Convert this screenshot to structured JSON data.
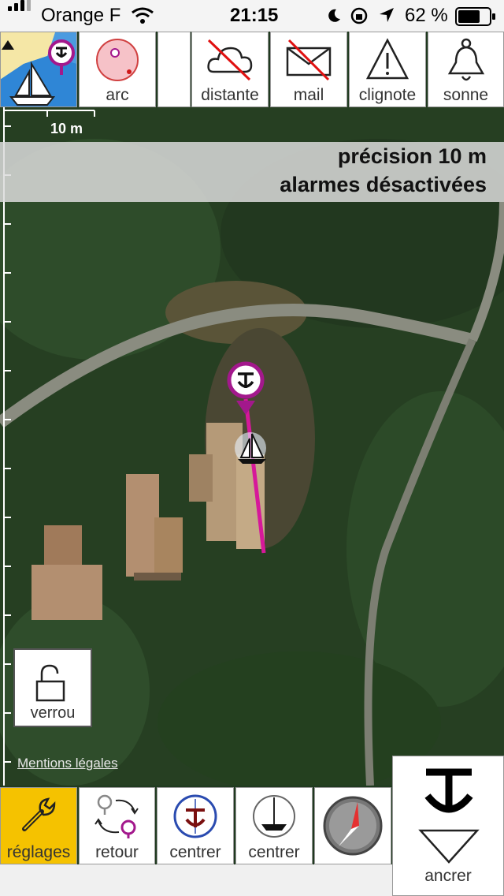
{
  "status_bar": {
    "carrier": "Orange F",
    "time": "21:15",
    "battery": "62 %"
  },
  "toolbar": {
    "arc_label": "arc",
    "distante_label": "distante",
    "mail_label": "mail",
    "clignote_label": "clignote",
    "sonne_label": "sonne"
  },
  "map": {
    "scale_label": "10 m",
    "precision_text": "précision 10 m",
    "alarm_text": "alarmes désactivées",
    "legal_link": "Mentions légales",
    "lock_label": "verrou"
  },
  "bottom_bar": {
    "reglages_label": "réglages",
    "retour_label": "retour",
    "centrer_anchor_label": "centrer",
    "centrer_boat_label": "centrer",
    "ancrer_label": "ancrer"
  },
  "colors": {
    "accent_magenta": "#c0188c",
    "active_yellow": "#f5c200",
    "compass_red": "#e53030"
  }
}
